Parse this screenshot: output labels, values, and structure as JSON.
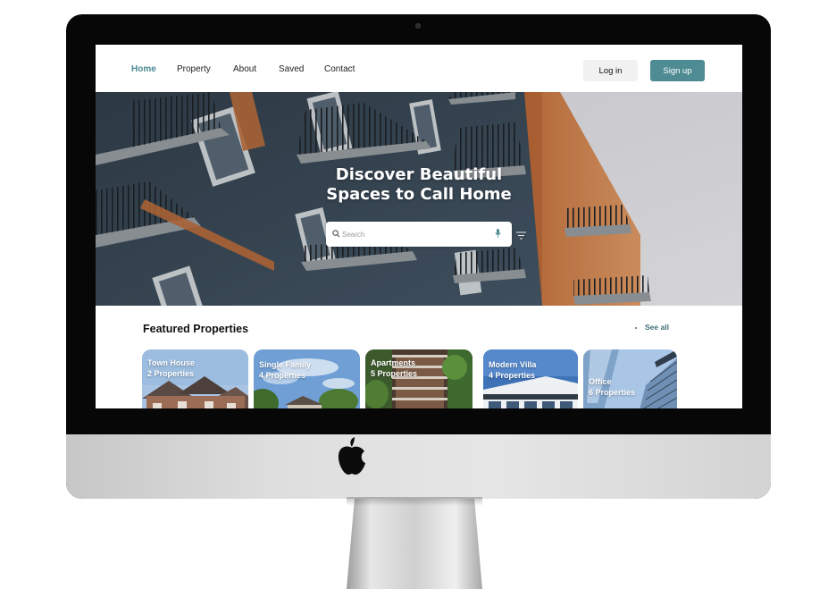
{
  "nav": {
    "links": [
      {
        "label": "Home",
        "active": true
      },
      {
        "label": "Property",
        "active": false
      },
      {
        "label": "About",
        "active": false
      },
      {
        "label": "Saved",
        "active": false
      },
      {
        "label": "Contact",
        "active": false
      }
    ],
    "login_label": "Log in",
    "signup_label": "Sign up"
  },
  "hero": {
    "title_line1": "Discover Beautiful",
    "title_line2": "Spaces to Call Home",
    "search_placeholder": "Search",
    "search_value": ""
  },
  "featured": {
    "title": "Featured Properties",
    "see_all_label": "See all",
    "categories": [
      {
        "name": "Town House",
        "count": "2 Properties"
      },
      {
        "name": "Single Family",
        "count": "4 Properties"
      },
      {
        "name": "Apartments",
        "count": "5 Properties"
      },
      {
        "name": "Modern Villa",
        "count": "4 Properties"
      },
      {
        "name": "Office",
        "count": "6 Properties"
      }
    ]
  },
  "colors": {
    "accent": "#4f8b92",
    "nav_active": "#4a8a91",
    "building_blue": "#3d4e5c",
    "building_orange": "#d8874e",
    "sky": "#e9e9ef"
  },
  "icons": [
    "search-icon",
    "microphone-icon",
    "filter-icon",
    "apple-logo-icon"
  ]
}
